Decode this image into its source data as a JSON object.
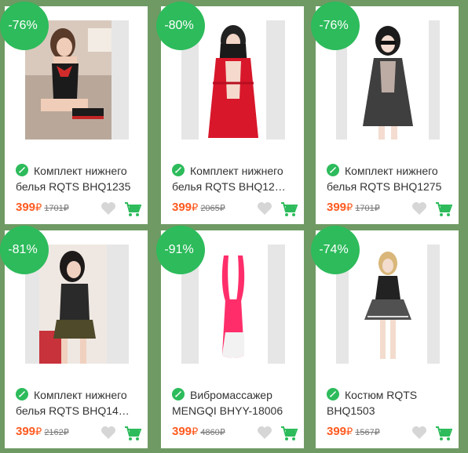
{
  "currency": "₽",
  "colors": {
    "accent": "#2dbb5b",
    "price": "#ff5a1f",
    "background": "#6f9a64"
  },
  "icons": {
    "title_icon": "rocket-icon",
    "wish": "heart-icon",
    "buy": "cart-icon"
  },
  "products": [
    {
      "discount": "-76%",
      "title": "Комплект нижнего белья RQTS BHQ1235",
      "price": "399",
      "old_price": "1701₽",
      "image": "black-red lingerie model photo"
    },
    {
      "discount": "-80%",
      "title": "Комплект нижнего белья RQTS BHQ12…",
      "price": "399",
      "old_price": "2065₽",
      "image": "red lace robe model photo"
    },
    {
      "discount": "-76%",
      "title": "Комплект нижнего белья RQTS BHQ1275",
      "price": "399",
      "old_price": "1701₽",
      "image": "black lace babydoll model photo"
    },
    {
      "discount": "-81%",
      "title": "Комплект нижнего белья RQTS BHQ14…",
      "price": "399",
      "old_price": "2162₽",
      "image": "costume model photo"
    },
    {
      "discount": "-91%",
      "title": "Вибромассажер MENGQI BHYY-18006",
      "price": "399",
      "old_price": "4860₽",
      "image": "pink massager product photo"
    },
    {
      "discount": "-74%",
      "title": "Костюм RQTS BHQ1503",
      "price": "399",
      "old_price": "1567₽",
      "image": "maid costume model photo"
    }
  ]
}
